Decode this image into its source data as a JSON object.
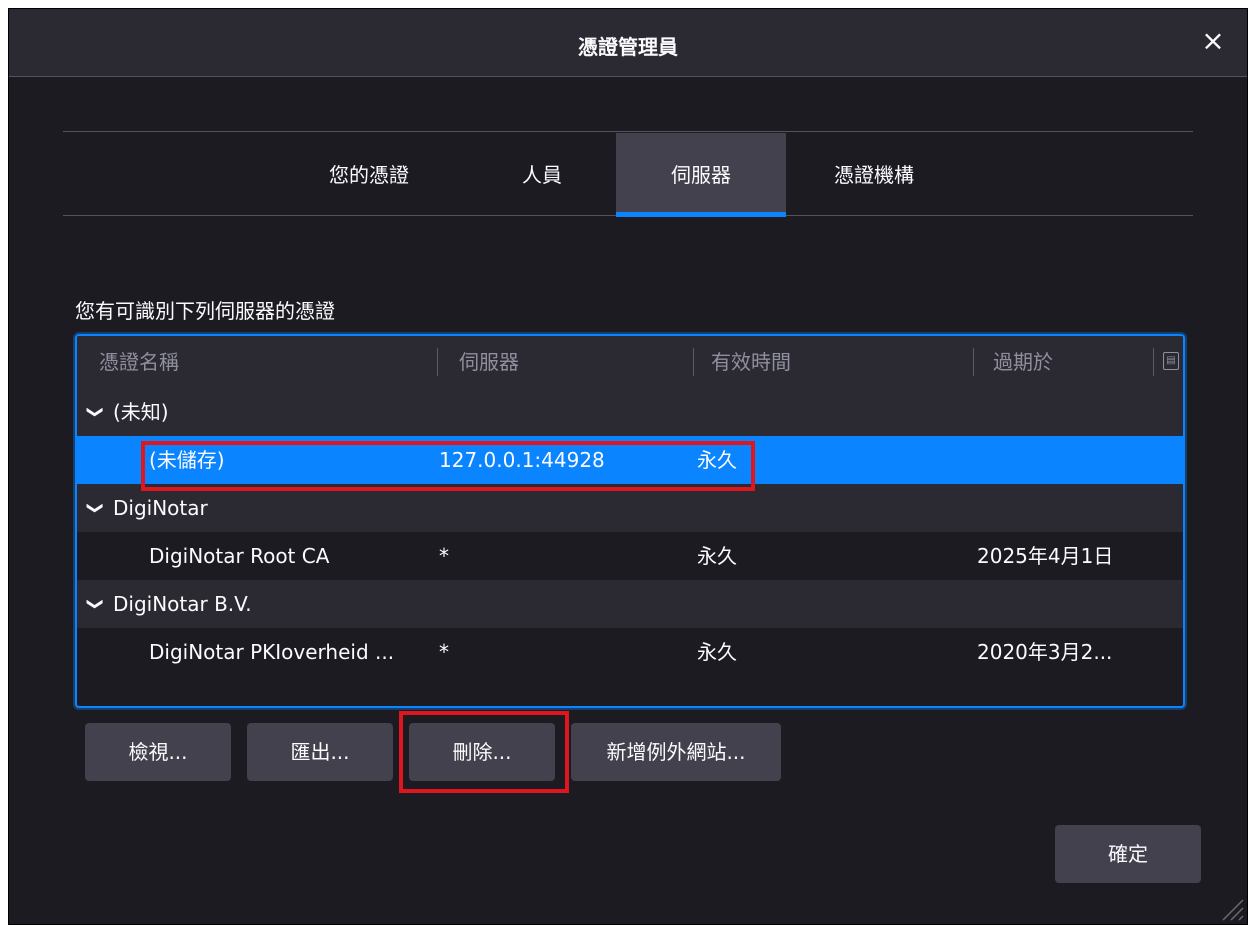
{
  "dialog": {
    "title": "憑證管理員",
    "close_label": "×"
  },
  "tabs": [
    {
      "label": "您的憑證",
      "selected": false
    },
    {
      "label": "人員",
      "selected": false
    },
    {
      "label": "伺服器",
      "selected": true
    },
    {
      "label": "憑證機構",
      "selected": false
    }
  ],
  "section_label": "您有可識別下列伺服器的憑證",
  "tree": {
    "columns": [
      "憑證名稱",
      "伺服器",
      "有效時間",
      "過期於"
    ],
    "column_picker_icon": "column-picker-icon",
    "groups": [
      {
        "name": "(未知)",
        "rows": [
          {
            "name": "(未儲存)",
            "server": "127.0.0.1:44928",
            "lifetime": "永久",
            "expires": "",
            "selected": true
          }
        ]
      },
      {
        "name": "DigiNotar",
        "rows": [
          {
            "name": "DigiNotar Root CA",
            "server": "*",
            "lifetime": "永久",
            "expires": "2025年4月1日",
            "selected": false
          }
        ]
      },
      {
        "name": "DigiNotar B.V.",
        "rows": [
          {
            "name": "DigiNotar PKIoverheid ...",
            "server": "*",
            "lifetime": "永久",
            "expires": "2020年3月2...",
            "selected": false
          }
        ]
      }
    ]
  },
  "buttons": {
    "view": "檢視...",
    "export": "匯出...",
    "delete": "刪除...",
    "add_exception": "新增例外網站...",
    "ok": "確定"
  },
  "colors": {
    "accent": "#0a84ff",
    "highlight_annotation": "#e0161e",
    "dialog_bg": "#1c1b22"
  }
}
